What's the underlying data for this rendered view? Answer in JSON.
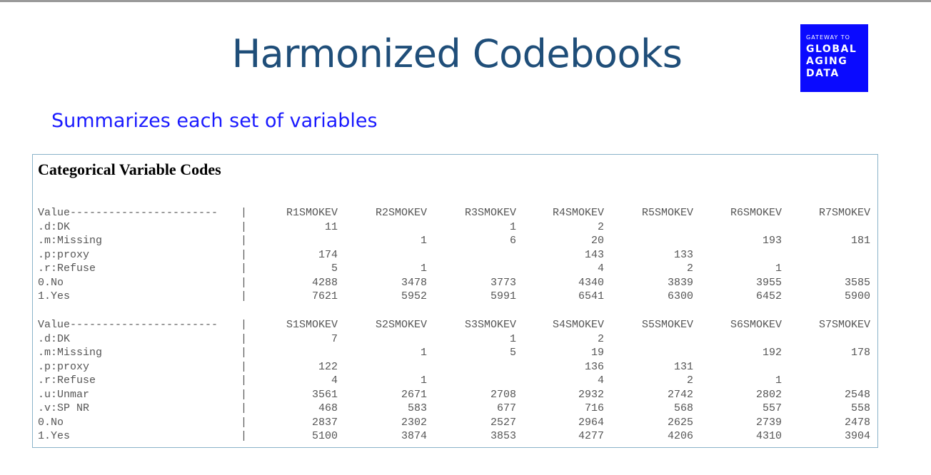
{
  "title": "Harmonized Codebooks",
  "logo": {
    "small": "GATEWAY TO",
    "lines": [
      "GLOBAL",
      "AGING",
      "DATA"
    ],
    "bg_color": "#0a0aff"
  },
  "subtitle": "Summarizes each set of variables",
  "codebox": {
    "title": "Categorical Variable Codes",
    "tables": [
      {
        "header": "Value-----------------------",
        "columns": [
          "R1SMOKEV",
          "R2SMOKEV",
          "R3SMOKEV",
          "R4SMOKEV",
          "R5SMOKEV",
          "R6SMOKEV",
          "R7SMOKEV"
        ],
        "rows": [
          {
            "label": ".d:DK",
            "values": [
              "11",
              "",
              "1",
              "2",
              "",
              "",
              ""
            ]
          },
          {
            "label": ".m:Missing",
            "values": [
              "",
              "1",
              "6",
              "20",
              "",
              "193",
              "181"
            ]
          },
          {
            "label": ".p:proxy",
            "values": [
              "174",
              "",
              "",
              "143",
              "133",
              "",
              ""
            ]
          },
          {
            "label": ".r:Refuse",
            "values": [
              "5",
              "1",
              "",
              "4",
              "2",
              "1",
              ""
            ]
          },
          {
            "label": "0.No",
            "values": [
              "4288",
              "3478",
              "3773",
              "4340",
              "3839",
              "3955",
              "3585"
            ]
          },
          {
            "label": "1.Yes",
            "values": [
              "7621",
              "5952",
              "5991",
              "6541",
              "6300",
              "6452",
              "5900"
            ]
          }
        ]
      },
      {
        "header": "Value-----------------------",
        "columns": [
          "S1SMOKEV",
          "S2SMOKEV",
          "S3SMOKEV",
          "S4SMOKEV",
          "S5SMOKEV",
          "S6SMOKEV",
          "S7SMOKEV"
        ],
        "rows": [
          {
            "label": ".d:DK",
            "values": [
              "7",
              "",
              "1",
              "2",
              "",
              "",
              ""
            ]
          },
          {
            "label": ".m:Missing",
            "values": [
              "",
              "1",
              "5",
              "19",
              "",
              "192",
              "178"
            ]
          },
          {
            "label": ".p:proxy",
            "values": [
              "122",
              "",
              "",
              "136",
              "131",
              "",
              ""
            ]
          },
          {
            "label": ".r:Refuse",
            "values": [
              "4",
              "1",
              "",
              "4",
              "2",
              "1",
              ""
            ]
          },
          {
            "label": ".u:Unmar",
            "values": [
              "3561",
              "2671",
              "2708",
              "2932",
              "2742",
              "2802",
              "2548"
            ]
          },
          {
            "label": ".v:SP NR",
            "values": [
              "468",
              "583",
              "677",
              "716",
              "568",
              "557",
              "558"
            ]
          },
          {
            "label": "0.No",
            "values": [
              "2837",
              "2302",
              "2527",
              "2964",
              "2625",
              "2739",
              "2478"
            ]
          },
          {
            "label": "1.Yes",
            "values": [
              "5100",
              "3874",
              "3853",
              "4277",
              "4206",
              "4310",
              "3904"
            ]
          }
        ]
      }
    ]
  }
}
